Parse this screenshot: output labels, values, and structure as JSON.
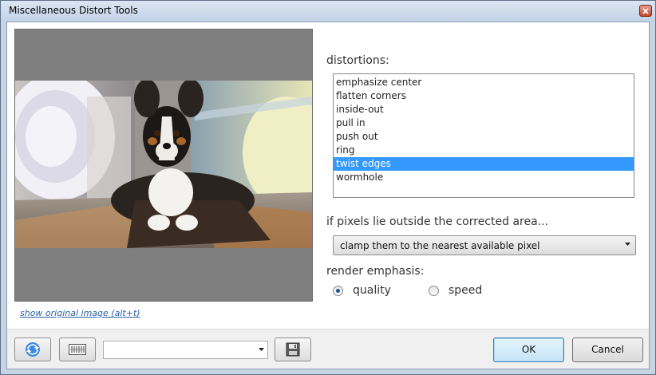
{
  "window": {
    "title": "Miscellaneous Distort Tools"
  },
  "preview": {
    "show_original_link": "show original image (alt+t)"
  },
  "distortions": {
    "label": "distortions:",
    "items": [
      {
        "label": "emphasize center"
      },
      {
        "label": "flatten corners"
      },
      {
        "label": "inside-out"
      },
      {
        "label": "pull in"
      },
      {
        "label": "push out"
      },
      {
        "label": "ring"
      },
      {
        "label": "twist edges"
      },
      {
        "label": "wormhole"
      }
    ],
    "selected": "twist edges"
  },
  "edge_handling": {
    "label": "if pixels lie outside the corrected area...",
    "selected_value": "clamp them to the nearest available pixel"
  },
  "render_emphasis": {
    "label": "render emphasis:",
    "options": [
      {
        "label": "quality",
        "checked": true
      },
      {
        "label": "speed",
        "checked": false
      }
    ]
  },
  "footer": {
    "preset_value": "",
    "ok_label": "OK",
    "cancel_label": "Cancel"
  },
  "colors": {
    "selection": "#3399ff",
    "link": "#2a5fa8",
    "preview_background": "#7f7f7f"
  },
  "icons": {
    "refresh": "refresh-icon",
    "randomize": "randomize-icon",
    "save_preset": "save-preset-icon",
    "close": "close-icon"
  }
}
